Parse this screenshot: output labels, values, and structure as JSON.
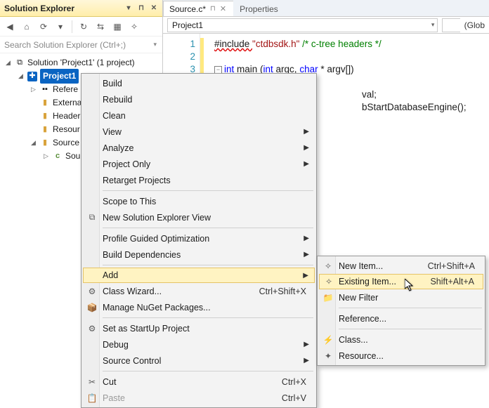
{
  "solution_explorer": {
    "title": "Solution Explorer",
    "search_placeholder": "Search Solution Explorer (Ctrl+;)",
    "solution_label": "Solution 'Project1' (1 project)",
    "project": "Project1",
    "nodes": {
      "references": "Refere",
      "external": "Externa",
      "header": "Header",
      "resource": "Resour",
      "source": "Source",
      "source_file": "Sou"
    }
  },
  "editor": {
    "tab_active": "Source.c*",
    "tab_inactive": "Properties",
    "combo_project": "Project1",
    "combo_global": "(Glob",
    "line_numbers": [
      "1",
      "2",
      "3"
    ],
    "code": {
      "l1_a": "#include ",
      "l1_b": "\"ctdbsdk.h\"",
      "l1_c": " /* c-tree headers */",
      "l3_a": "int",
      "l3_b": " main (",
      "l3_c": "int",
      "l3_d": " argc, ",
      "l3_e": "char",
      "l3_f": " * argv[])",
      "l5": "val;",
      "l6": "bStartDatabaseEngine();"
    }
  },
  "context_menu": [
    {
      "label": "Build"
    },
    {
      "label": "Rebuild"
    },
    {
      "label": "Clean"
    },
    {
      "label": "View",
      "submenu": true
    },
    {
      "label": "Analyze",
      "submenu": true
    },
    {
      "label": "Project Only",
      "submenu": true
    },
    {
      "label": "Retarget Projects"
    },
    {
      "sep": true
    },
    {
      "label": "Scope to This"
    },
    {
      "label": "New Solution Explorer View",
      "icon": "⧉"
    },
    {
      "sep": true
    },
    {
      "label": "Profile Guided Optimization",
      "submenu": true
    },
    {
      "label": "Build Dependencies",
      "submenu": true
    },
    {
      "sep": true
    },
    {
      "label": "Add",
      "submenu": true,
      "hl": true
    },
    {
      "label": "Class Wizard...",
      "shortcut": "Ctrl+Shift+X",
      "icon": "⚙"
    },
    {
      "label": "Manage NuGet Packages...",
      "icon": "📦"
    },
    {
      "sep": true
    },
    {
      "label": "Set as StartUp Project",
      "icon": "⚙"
    },
    {
      "label": "Debug",
      "submenu": true
    },
    {
      "label": "Source Control",
      "submenu": true
    },
    {
      "sep": true
    },
    {
      "label": "Cut",
      "shortcut": "Ctrl+X",
      "icon": "✂"
    },
    {
      "label": "Paste",
      "shortcut": "Ctrl+V",
      "disabled": true,
      "icon": "📋"
    }
  ],
  "add_submenu": [
    {
      "label": "New Item...",
      "shortcut": "Ctrl+Shift+A",
      "icon": "✧"
    },
    {
      "label": "Existing Item...",
      "shortcut": "Shift+Alt+A",
      "icon": "✧",
      "hl": true
    },
    {
      "label": "New Filter",
      "icon": "📁"
    },
    {
      "sep": true
    },
    {
      "label": "Reference..."
    },
    {
      "sep": true
    },
    {
      "label": "Class...",
      "icon": "⚡"
    },
    {
      "label": "Resource...",
      "icon": "✦"
    }
  ]
}
